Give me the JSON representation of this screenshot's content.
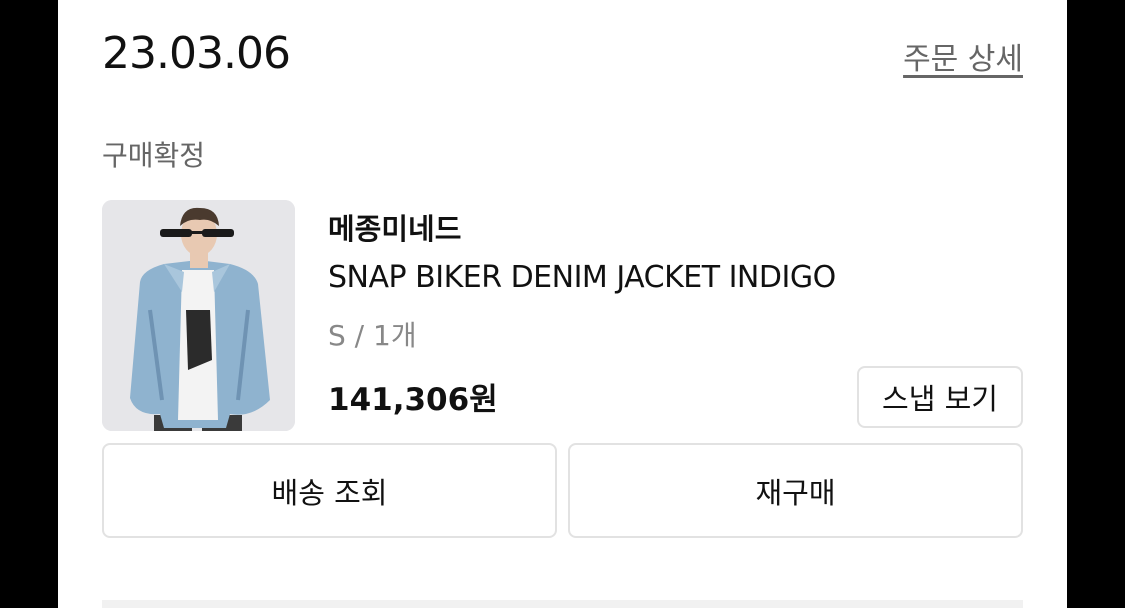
{
  "order": {
    "date": "23.03.06",
    "detail_link": "주문 상세",
    "status": "구매확정"
  },
  "product": {
    "brand": "메종미네드",
    "name": "SNAP BIKER DENIM JACKET INDIGO",
    "option": "S / 1개",
    "price": "141,306원",
    "thumbnail_icon": "denim-jacket-model-photo"
  },
  "actions": {
    "snap_label": "스냅 보기",
    "delivery_label": "배송 조회",
    "rebuy_label": "재구매"
  },
  "colors": {
    "background": "#000000",
    "panel": "#ffffff",
    "text_primary": "#111111",
    "text_secondary": "#666666",
    "button_border": "#e2e2e2"
  }
}
